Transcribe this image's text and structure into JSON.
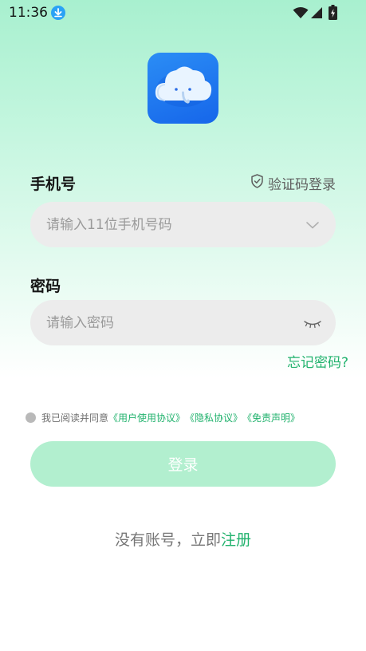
{
  "status_bar": {
    "time": "11:36"
  },
  "form": {
    "phone_label": "手机号",
    "sms_login_label": "验证码登录",
    "phone_placeholder": "请输入11位手机号码",
    "phone_value": "",
    "password_label": "密码",
    "password_placeholder": "请输入密码",
    "password_value": "",
    "forgot_password": "忘记密码?"
  },
  "agreement": {
    "prefix": "我已阅读并同意",
    "user_agreement": "《用户使用协议》",
    "privacy": "《隐私协议》",
    "disclaimer": "《免责声明》"
  },
  "login_button": "登录",
  "register": {
    "prefix": "没有账号，立即",
    "link": "注册"
  },
  "colors": {
    "accent": "#21b26d",
    "login_button_bg": "#b2efcf",
    "field_bg": "#ececec",
    "logo_blue": "#1f78ee"
  }
}
